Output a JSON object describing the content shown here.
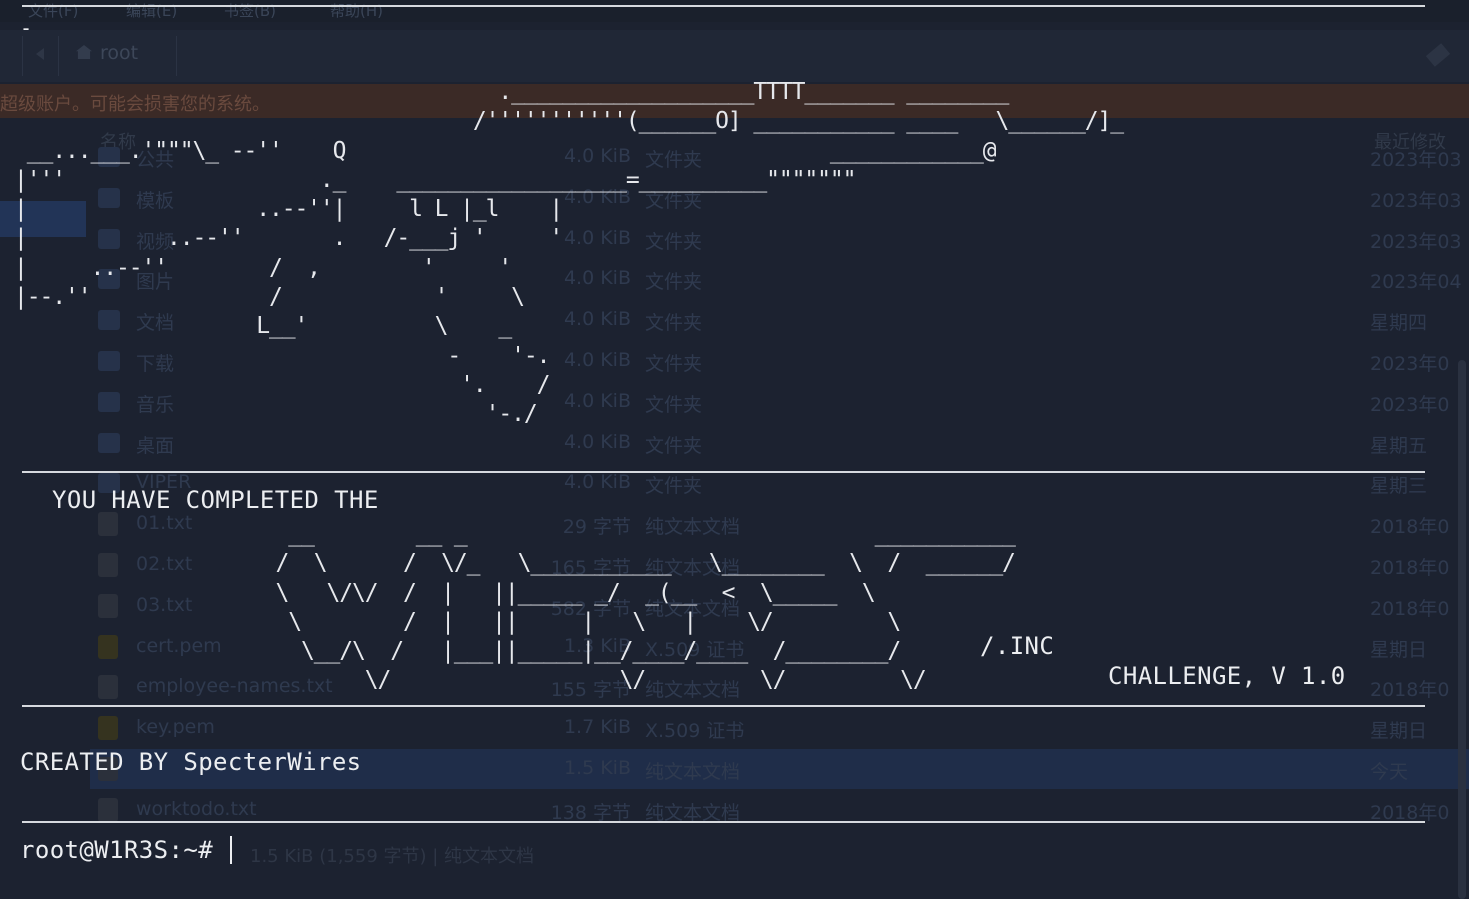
{
  "file_manager": {
    "menubar": [
      "文件(F)",
      "编辑(E)",
      "书签(B)",
      "帮助(H)"
    ],
    "breadcrumb": "root",
    "warning": "超级账户。可能会损害您的系统。",
    "columns": {
      "name": "名称",
      "size": "大小",
      "type": "文件类型",
      "modified": "最近修改"
    },
    "rows": [
      {
        "name": "公共",
        "size": "4.0 KiB",
        "type": "文件夹",
        "date": "2023年03",
        "kind": "folder"
      },
      {
        "name": "模板",
        "size": "4.0 KiB",
        "type": "文件夹",
        "date": "2023年03",
        "kind": "folder"
      },
      {
        "name": "视频",
        "size": "4.0 KiB",
        "type": "文件夹",
        "date": "2023年03",
        "kind": "folder"
      },
      {
        "name": "图片",
        "size": "4.0 KiB",
        "type": "文件夹",
        "date": "2023年04",
        "kind": "folder"
      },
      {
        "name": "文档",
        "size": "4.0 KiB",
        "type": "文件夹",
        "date": "星期四",
        "kind": "folder"
      },
      {
        "name": "下载",
        "size": "4.0 KiB",
        "type": "文件夹",
        "date": "2023年0",
        "kind": "folder"
      },
      {
        "name": "音乐",
        "size": "4.0 KiB",
        "type": "文件夹",
        "date": "2023年0",
        "kind": "folder"
      },
      {
        "name": "桌面",
        "size": "4.0 KiB",
        "type": "文件夹",
        "date": "星期五",
        "kind": "folder"
      },
      {
        "name": "VIPER",
        "size": "4.0 KiB",
        "type": "文件夹",
        "date": "星期三",
        "kind": "folder"
      },
      {
        "name": "01.txt",
        "size": "29 字节",
        "type": "纯文本文档",
        "date": "2018年0",
        "kind": "file"
      },
      {
        "name": "02.txt",
        "size": "165 字节",
        "type": "纯文本文档",
        "date": "2018年0",
        "kind": "file"
      },
      {
        "name": "03.txt",
        "size": "582 字节",
        "type": "纯文本文档",
        "date": "2018年0",
        "kind": "file"
      },
      {
        "name": "cert.pem",
        "size": "1.3 KiB",
        "type": "X.509 证书",
        "date": "星期日",
        "kind": "cert"
      },
      {
        "name": "employee-names.txt",
        "size": "155 字节",
        "type": "纯文本文档",
        "date": "2018年0",
        "kind": "file"
      },
      {
        "name": "key.pem",
        "size": "1.7 KiB",
        "type": "X.509 证书",
        "date": "星期日",
        "kind": "cert"
      },
      {
        "name": "",
        "size": "1.5 KiB",
        "type": "纯文本文档",
        "date": "今天",
        "kind": "file",
        "selected": true
      },
      {
        "name": "worktodo.txt",
        "size": "138 字节",
        "type": "纯文本文档",
        "date": "2018年0",
        "kind": "file"
      }
    ],
    "status": "1.5 KiB (1,559 字节) | 纯文本文档"
  },
  "terminal": {
    "top_cursor": "-",
    "gun_ascii": "                                      .___________________TTTT_______ ________\n                                    /'''''''''''(______O] ___________ ____   \\______/]_\n __...___.'\"\"\"\\_ --''    Q                                      ____________@\n|'''                    ._    __________________=__________\"\"\"\"\"\"\"\n|                  ..--''|     l L |_l    |\n|           ..--''       .   /-___j '     '\n|     ..--''        /  ,        '     '\n|--.''              /            '     \\\n                   L__'          \\    _\n                                  -    '-.\n                                   '.    /\n                                     '-./",
    "completed_text": "YOU HAVE COMPLETED THE",
    "logo_ascii": "           __        __ _                                ___________\n          /  \\      /  \\/_   \\___________   \\________  \\  /  ______/\n          \\   \\/\\/  /  |   ||_____ _/  _(__  <  \\_____  \\\n           \\        /  |   ||     |   \\   |    \\/         \\\n            \\__/\\  /   |___||_____|__/____/____  /________/\n                 \\/                  \\/         \\/         \\/",
    "inc_label": "/.INC",
    "challenge_label": "CHALLENGE, V 1.0",
    "created_by": "CREATED BY SpecterWires",
    "prompt": "root@W1R3S:~# "
  }
}
